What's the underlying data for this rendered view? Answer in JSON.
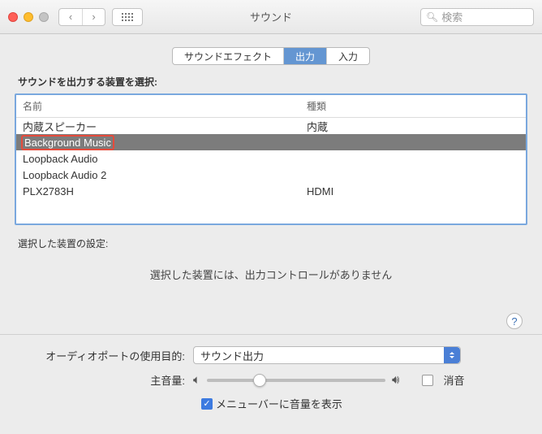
{
  "window": {
    "title": "サウンド",
    "search_placeholder": "検索"
  },
  "tabs": {
    "effects": "サウンドエフェクト",
    "output": "出力",
    "input": "入力"
  },
  "panel": {
    "select_device_label": "サウンドを出力する装置を選択:",
    "col_name": "名前",
    "col_type": "種類",
    "devices": [
      {
        "name": "内蔵スピーカー",
        "type": "内蔵"
      },
      {
        "name": "Background Music",
        "type": ""
      },
      {
        "name": "Loopback Audio",
        "type": ""
      },
      {
        "name": "Loopback Audio 2",
        "type": ""
      },
      {
        "name": "PLX2783H",
        "type": "HDMI"
      }
    ],
    "settings_label": "選択した装置の設定:",
    "no_output_msg": "選択した装置には、出力コントロールがありません"
  },
  "footer": {
    "port_label": "オーディオポートの使用目的:",
    "port_value": "サウンド出力",
    "volume_label": "主音量:",
    "mute_label": "消音",
    "menubar_label": "メニューバーに音量を表示"
  }
}
